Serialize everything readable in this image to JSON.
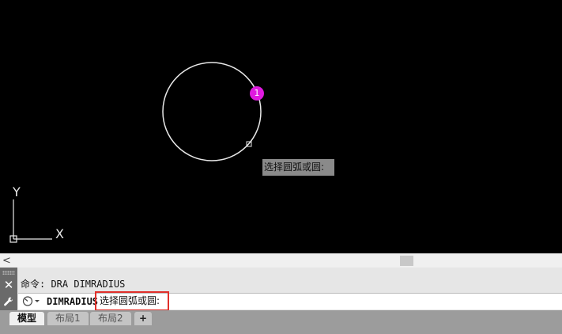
{
  "drawing": {
    "marker_number": "1",
    "tooltip": "选择圆弧或圆:",
    "ucs": {
      "x_label": "X",
      "y_label": "Y"
    },
    "colors": {
      "background": "#000000",
      "circle": "#e8e8e8",
      "marker": "#e01ae0"
    }
  },
  "scrollbar": {
    "left_arrow": "<"
  },
  "command": {
    "close_glyph": "✕",
    "history_line": "命令: DRA DIMRADIUS",
    "current_command": "DIMRADIUS",
    "prompt": "选择圆弧或圆:",
    "icon": "command-recent-icon"
  },
  "tabs": [
    {
      "label": "模型",
      "active": true
    },
    {
      "label": "布局1",
      "active": false
    },
    {
      "label": "布局2",
      "active": false
    }
  ],
  "add_tab_label": "+"
}
